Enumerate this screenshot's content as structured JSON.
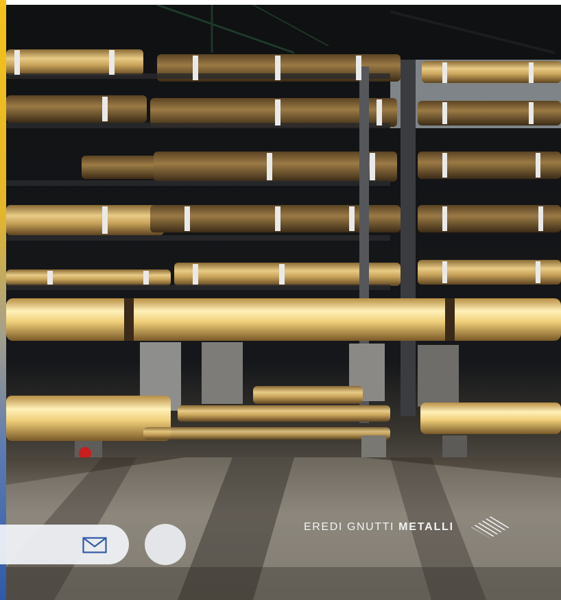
{
  "brand": {
    "name_light": "EREDI GNUTTI",
    "name_bold": "METALLI",
    "logo_icon": "diagonal-stripes-diamond-logo"
  },
  "hero": {
    "subject": "warehouse-racks-brass-rods-photo"
  },
  "controls": {
    "mail_icon": "envelope-icon",
    "round_button_icon": "blank-circle"
  },
  "colors": {
    "accent_top": "#f4c21a",
    "accent_bottom": "#2f5aa8",
    "brass": "#c9a35a",
    "pill_bg": "#f2f4f8",
    "icon_blue": "#2f5aa8"
  }
}
